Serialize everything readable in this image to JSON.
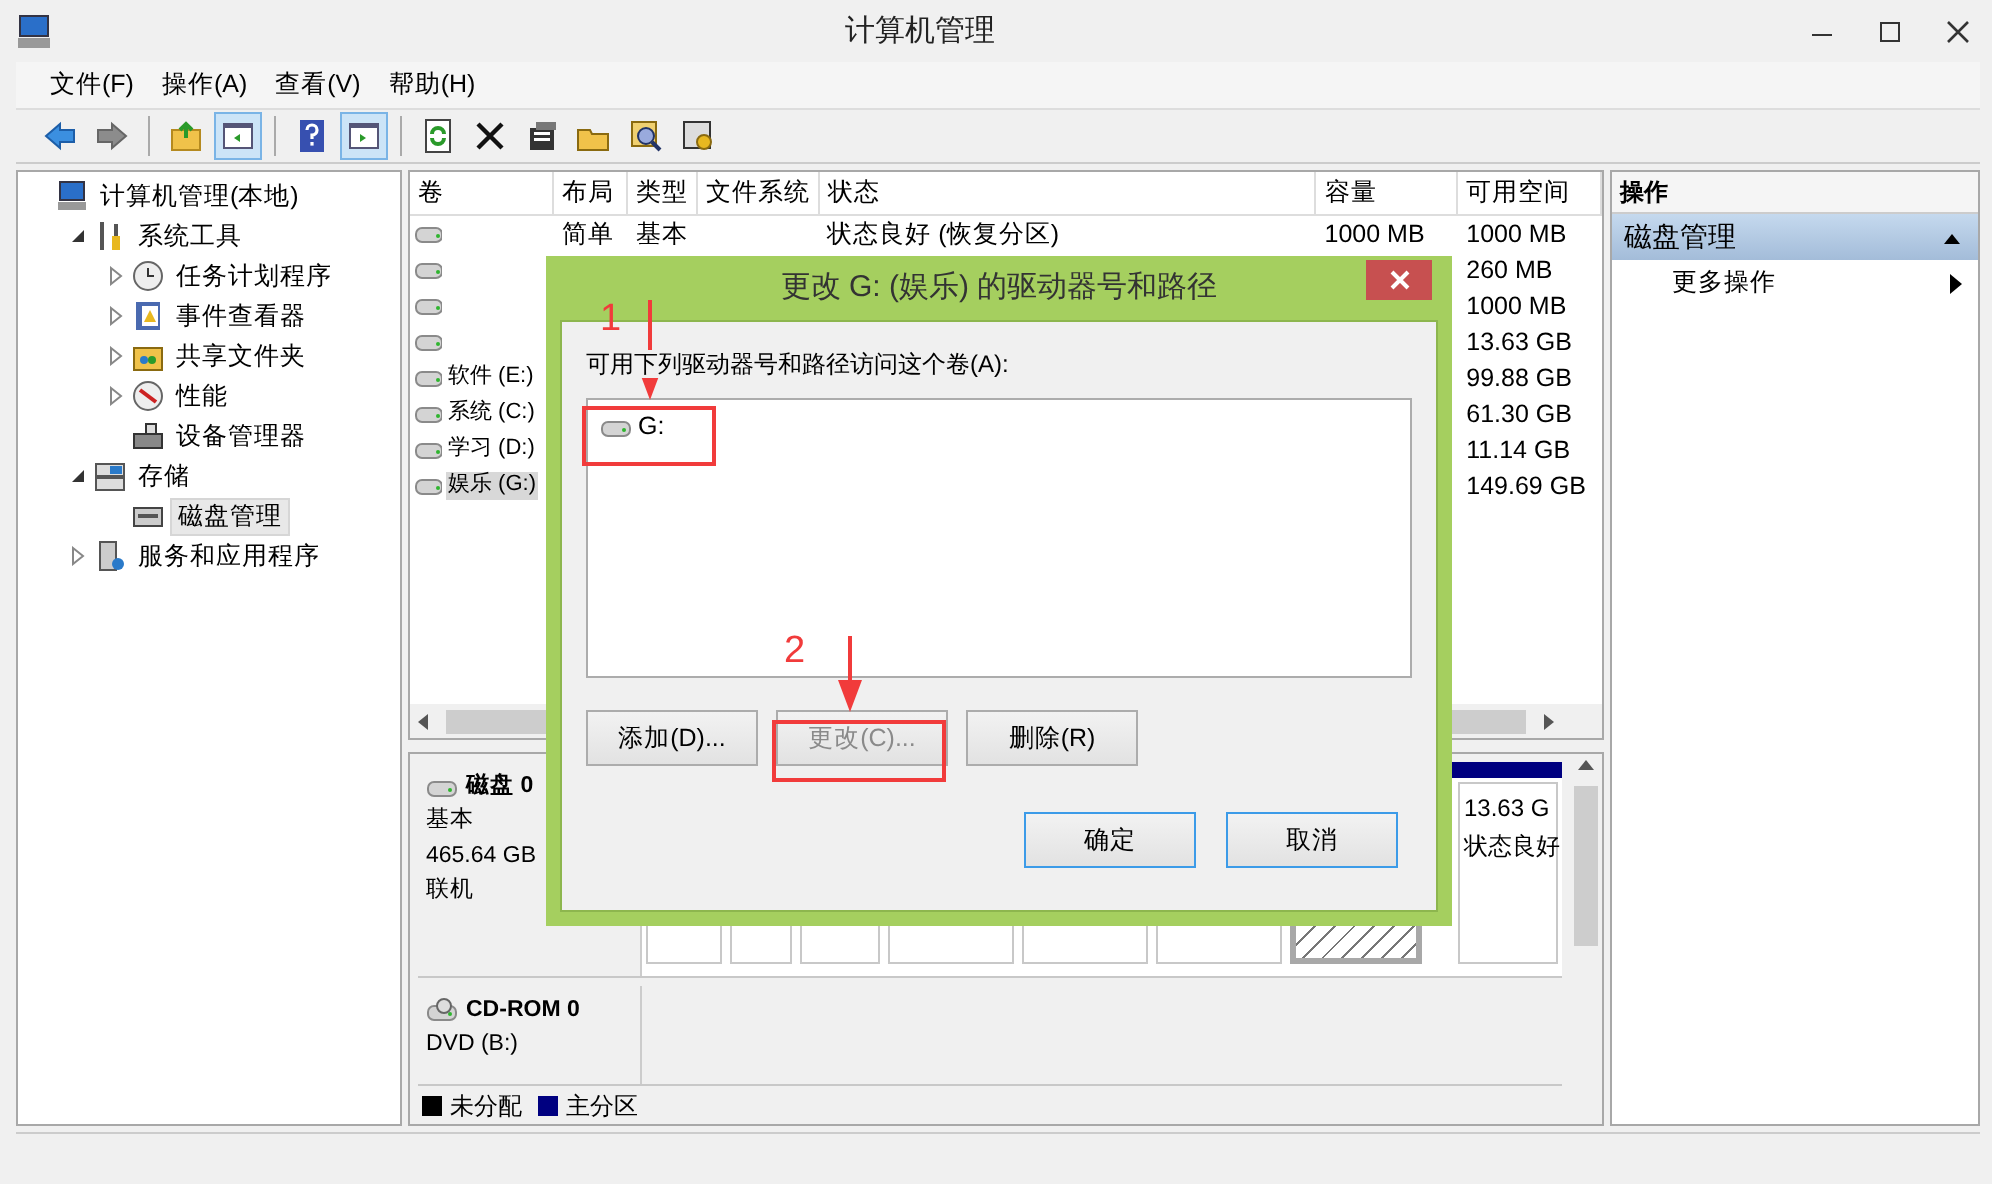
{
  "window": {
    "title": "计算机管理"
  },
  "menu": [
    "文件(F)",
    "操作(A)",
    "查看(V)",
    "帮助(H)"
  ],
  "toolbar": [
    [
      {
        "kind": "back",
        "selected": false
      },
      {
        "kind": "forward",
        "selected": false
      }
    ],
    [
      {
        "kind": "up",
        "selected": false
      },
      {
        "kind": "tree_toggle",
        "selected": true
      }
    ],
    [
      {
        "kind": "help",
        "selected": false
      },
      {
        "kind": "action_toggle",
        "selected": true
      }
    ],
    [
      {
        "kind": "refresh",
        "selected": false
      },
      {
        "kind": "delete",
        "selected": false
      },
      {
        "kind": "properties",
        "selected": false
      },
      {
        "kind": "open",
        "selected": false
      },
      {
        "kind": "find",
        "selected": false
      },
      {
        "kind": "settings",
        "selected": false
      }
    ]
  ],
  "tree": [
    {
      "label": "计算机管理(本地)",
      "kind": "computer",
      "selected": false,
      "children": [
        {
          "label": "系统工具",
          "kind": "tools",
          "expanded": true,
          "selected": false,
          "children": [
            {
              "label": "任务计划程序",
              "kind": "clock",
              "expanded": false,
              "selected": false
            },
            {
              "label": "事件查看器",
              "kind": "log",
              "expanded": false,
              "selected": false
            },
            {
              "label": "共享文件夹",
              "kind": "share",
              "expanded": false,
              "selected": false
            },
            {
              "label": "性能",
              "kind": "perf",
              "expanded": false,
              "selected": false
            },
            {
              "label": "设备管理器",
              "kind": "device",
              "selected": false
            }
          ]
        },
        {
          "label": "存储",
          "kind": "storage",
          "expanded": true,
          "selected": false,
          "children": [
            {
              "label": "磁盘管理",
              "kind": "disk",
              "selected": true
            }
          ]
        },
        {
          "label": "服务和应用程序",
          "kind": "services",
          "expanded": false,
          "selected": false
        }
      ]
    }
  ],
  "table": {
    "columns": [
      "卷",
      "布局",
      "类型",
      "文件系统",
      "状态",
      "容量",
      "可用空间"
    ],
    "rows": [
      {
        "layout": "简单",
        "type": "基本",
        "status": "状态良好 (恢复分区)",
        "capacity": "1000 MB",
        "free_space": "1000 MB",
        "selected": false
      },
      {
        "free_space": "260 MB",
        "selected": false
      },
      {
        "free_space": "1000 MB",
        "selected": false
      },
      {
        "free_space": "13.63 GB",
        "selected": false
      },
      {
        "volume": "软件 (E:)",
        "free_space": "99.88 GB",
        "selected": false
      },
      {
        "volume": "系统 (C:)",
        "free_space": "61.30 GB",
        "selected": false
      },
      {
        "volume": "学习 (D:)",
        "free_space": "11.14 GB",
        "selected": false
      },
      {
        "volume": "娱乐 (G:)",
        "free_space": "149.69 GB",
        "selected": true
      }
    ]
  },
  "disks": [
    {
      "kind": "hdd",
      "name": "磁盘 0",
      "lines": [
        "基本",
        "465.64 GB",
        "联机"
      ],
      "partitions": [
        {
          "selected": false
        },
        {
          "selected": false
        },
        {
          "selected": false
        },
        {
          "selected": false
        },
        {
          "selected": false
        },
        {
          "selected": false
        },
        {
          "selected": true
        },
        {
          "selected": false,
          "size": "13.63 G",
          "status": "状态良好"
        }
      ]
    },
    {
      "kind": "cdrom",
      "name": "CD-ROM 0",
      "lines": [
        "DVD (B:)"
      ]
    }
  ],
  "legend": [
    {
      "label": "未分配",
      "color": "#000000"
    },
    {
      "label": "主分区",
      "color": "#000080"
    }
  ],
  "actions": {
    "title": "操作",
    "sections": [
      {
        "title": "磁盘管理",
        "expanded": true,
        "items": [
          "更多操作"
        ]
      }
    ]
  },
  "dialog": {
    "title": "更改 G: (娱乐) 的驱动器号和路径",
    "prompt": "可用下列驱动器号和路径访问这个卷(A):",
    "paths": [
      {
        "label": "G:",
        "selected": false
      }
    ],
    "path_buttons": [
      {
        "label": "添加(D)...",
        "disabled": false,
        "highlighted": false
      },
      {
        "label": "更改(C)...",
        "disabled": true,
        "highlighted": false
      },
      {
        "label": "删除(R)",
        "disabled": false,
        "highlighted": false
      }
    ],
    "buttons": [
      {
        "label": "确定",
        "disabled": false,
        "highlighted": true
      },
      {
        "label": "取消",
        "disabled": false,
        "highlighted": true
      }
    ]
  },
  "annotations": [
    {
      "label": "1"
    },
    {
      "label": "2"
    }
  ]
}
